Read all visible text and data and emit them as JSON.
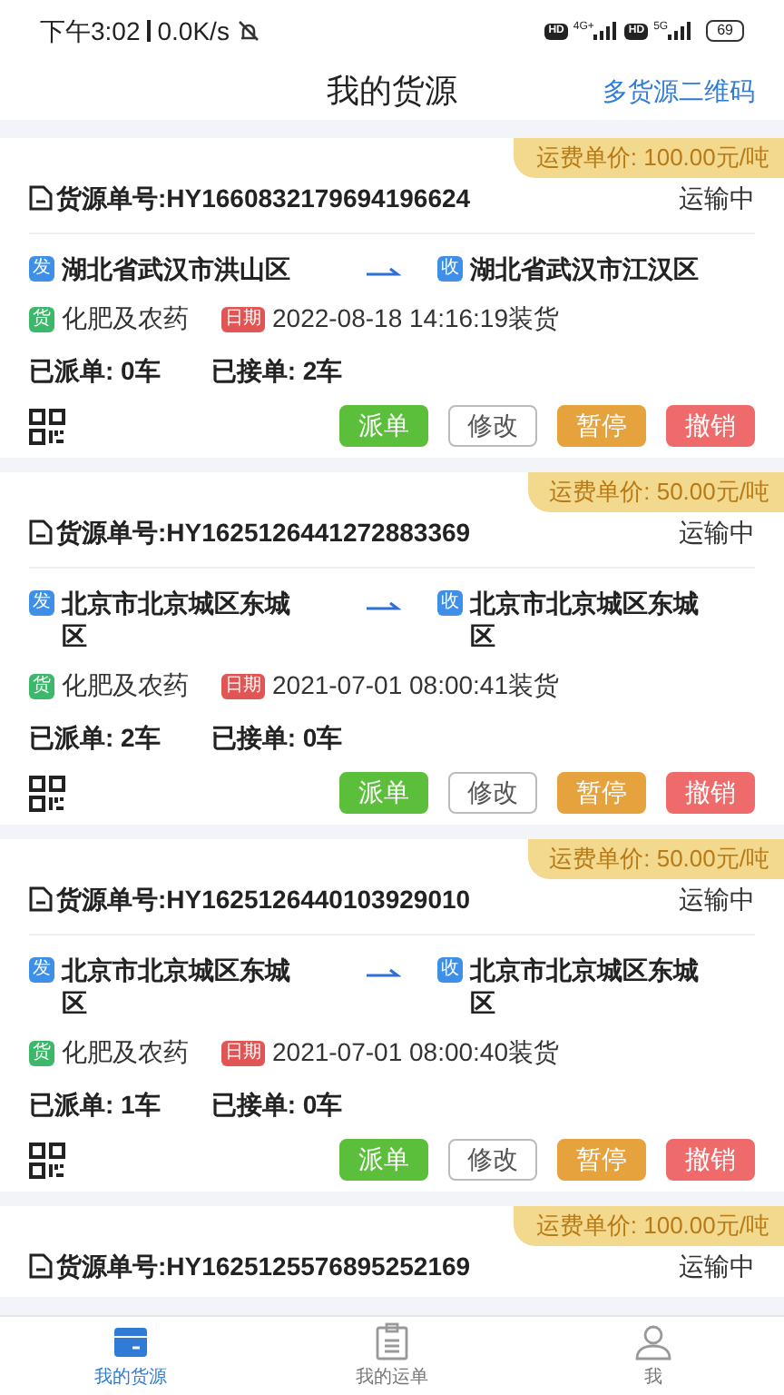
{
  "status_bar": {
    "time": "下午3:02",
    "speed": "0.0K/s",
    "hd_1": "HD",
    "network_1": "4G+",
    "hd_2": "HD",
    "network_2": "5G",
    "battery": "69"
  },
  "header": {
    "title": "我的货源",
    "action": "多货源二维码"
  },
  "cards": [
    {
      "price": "运费单价: 100.00元/吨",
      "order_no": "货源单号:HY1660832179694196624",
      "status": "运输中",
      "from_tag": "发",
      "from": "湖北省武汉市洪山区",
      "to_tag": "收",
      "to": "湖北省武汉市江汉区",
      "goods_tag": "货",
      "goods": "化肥及农药",
      "date_tag": "日期",
      "date": "2022-08-18 14:16:19装货",
      "dispatched": "已派单: 0车",
      "accepted": "已接单: 2车",
      "buttons": [
        {
          "label": "派单",
          "kind": "green"
        },
        {
          "label": "修改",
          "kind": "outline"
        },
        {
          "label": "暂停",
          "kind": "orange"
        },
        {
          "label": "撤销",
          "kind": "red"
        }
      ]
    },
    {
      "price": "运费单价: 50.00元/吨",
      "order_no": "货源单号:HY1625126441272883369",
      "status": "运输中",
      "from_tag": "发",
      "from": "北京市北京城区东城区",
      "to_tag": "收",
      "to": "北京市北京城区东城区",
      "goods_tag": "货",
      "goods": "化肥及农药",
      "date_tag": "日期",
      "date": "2021-07-01 08:00:41装货",
      "dispatched": "已派单: 2车",
      "accepted": "已接单: 0车",
      "buttons": [
        {
          "label": "派单",
          "kind": "green"
        },
        {
          "label": "修改",
          "kind": "outline"
        },
        {
          "label": "暂停",
          "kind": "orange"
        },
        {
          "label": "撤销",
          "kind": "red"
        }
      ]
    },
    {
      "price": "运费单价: 50.00元/吨",
      "order_no": "货源单号:HY1625126440103929010",
      "status": "运输中",
      "from_tag": "发",
      "from": "北京市北京城区东城区",
      "to_tag": "收",
      "to": "北京市北京城区东城区",
      "goods_tag": "货",
      "goods": "化肥及农药",
      "date_tag": "日期",
      "date": "2021-07-01 08:00:40装货",
      "dispatched": "已派单: 1车",
      "accepted": "已接单: 0车",
      "buttons": [
        {
          "label": "派单",
          "kind": "green"
        },
        {
          "label": "修改",
          "kind": "outline"
        },
        {
          "label": "暂停",
          "kind": "orange"
        },
        {
          "label": "撤销",
          "kind": "red"
        }
      ]
    },
    {
      "price": "运费单价: 100.00元/吨",
      "order_no": "货源单号:HY1625125576895252169",
      "status": "运输中"
    }
  ],
  "tab_bar": [
    {
      "label": "我的货源",
      "kind": "box",
      "selected": true
    },
    {
      "label": "我的运单",
      "kind": "clipboard",
      "selected": false
    },
    {
      "label": "我",
      "kind": "person",
      "selected": false
    }
  ]
}
